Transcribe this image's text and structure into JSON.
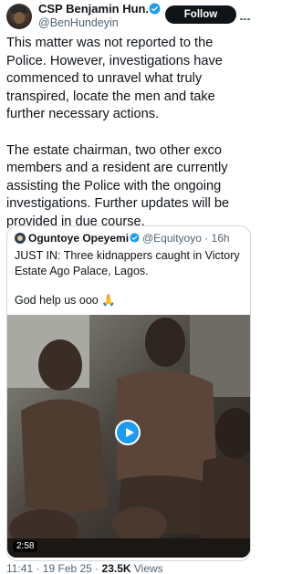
{
  "author": {
    "name": "CSP Benjamin Hun...",
    "handle": "@BenHundeyin",
    "verified_color": "#1d9bf0"
  },
  "follow_label": "Follow",
  "tweet": {
    "paragraphs": [
      "This matter was not reported to the Police. However, investigations have commenced to unravel what truly transpired, locate the men and take further necessary actions.",
      "The estate chairman, two other exco members and a resident are currently assisting the Police with the ongoing investigations. Further updates will be provided in due course."
    ]
  },
  "quote": {
    "name": "Oguntoye Opeyemi",
    "handle": "@Equityoyo · 16h",
    "text_line1": "JUST IN:  Three kidnappers caught in Victory Estate Ago Palace, Lagos.",
    "text_line2": "God help us ooo 🙏",
    "video": {
      "duration": "2:58",
      "play_icon": "play-icon"
    }
  },
  "footer": {
    "time": "11:41 · 19 Feb 25 · ",
    "views_count": "23.5K",
    "views_label": " Views"
  }
}
